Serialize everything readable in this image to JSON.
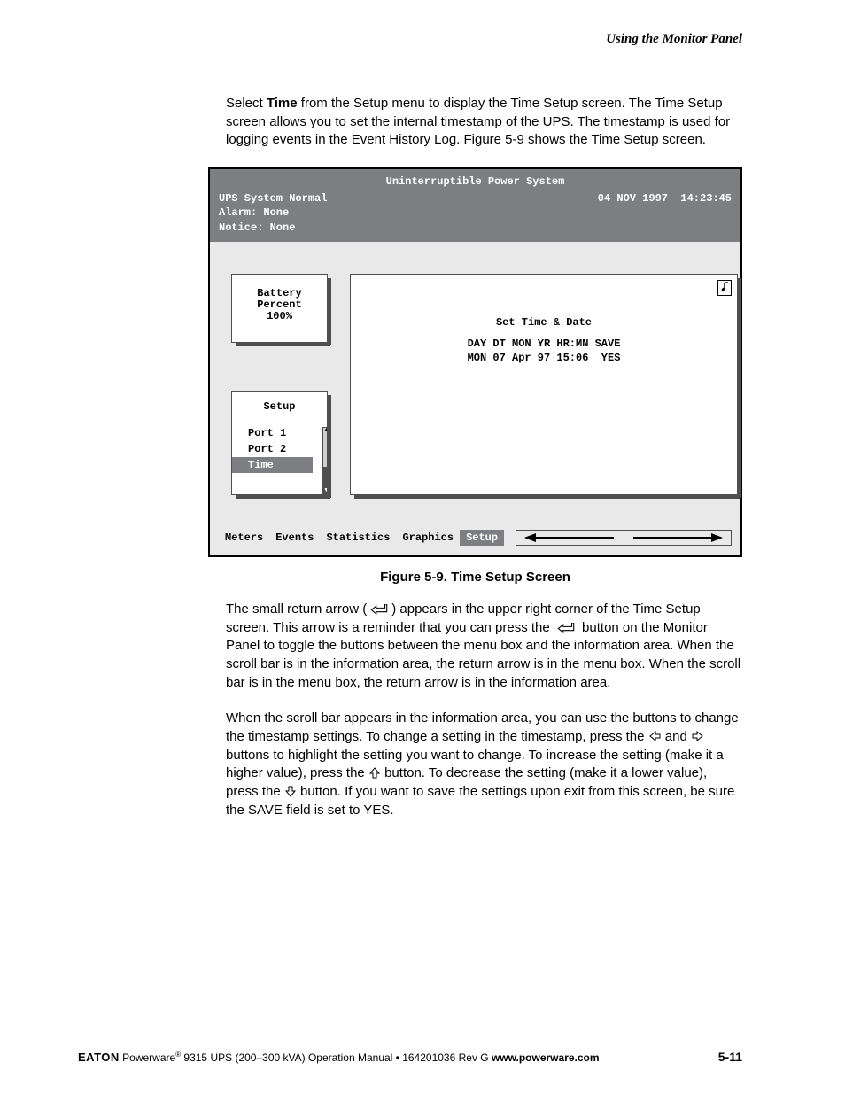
{
  "header": {
    "section_title": "Using the Monitor Panel"
  },
  "intro": {
    "p1_a": "Select ",
    "p1_bold": "Time",
    "p1_b": " from the Setup menu to display the Time Setup screen. The Time Setup screen allows you to set the internal timestamp of the UPS. The timestamp is used for logging events in the Event History Log. Figure 5-9 shows the Time Setup screen."
  },
  "lcd": {
    "title": "Uninterruptible Power System",
    "status_left_1": "UPS System Normal",
    "status_left_2": "Alarm:  None",
    "status_left_3": "Notice: None",
    "date": "04 NOV 1997",
    "time": "14:23:45",
    "battery": {
      "l1": "Battery",
      "l2": "Percent",
      "l3": "100%"
    },
    "setup": {
      "title": "Setup",
      "items": [
        "Port 1",
        "Port 2",
        "Time"
      ],
      "selected_index": 2
    },
    "info": {
      "title": "Set Time & Date",
      "header_row": "DAY DT MON YR HR:MN SAVE",
      "value_row": "MON 07 Apr 97 15:06  YES"
    },
    "footer_tabs": [
      "Meters",
      "Events",
      "Statistics",
      "Graphics",
      "Setup"
    ],
    "footer_selected_index": 4
  },
  "caption": "Figure 5-9. Time Setup Screen",
  "para2": {
    "a": "The small return arrow (",
    "b": ") appears in the upper right corner of the Time Setup screen. This arrow is a reminder that you can press the ",
    "c": " button on the Monitor Panel to toggle the buttons between the menu box and the information area. When the scroll bar is in the information area, the return arrow is in the menu box. When the scroll bar is in the menu box, the return arrow is in the information area."
  },
  "para3": {
    "a": "When the scroll bar appears in the information area, you can use the buttons to change the timestamp settings. To change a setting in the timestamp, press the ",
    "b": " and ",
    "c": " buttons to highlight the setting you want to change. To increase the setting (make it a higher value), press the ",
    "d": " button. To decrease the setting (make it a lower value), press the ",
    "e": " button. If you want to save the settings upon exit from this screen, be sure the SAVE field is set to YES."
  },
  "footer": {
    "brand": "EATON",
    "product_a": " Powerware",
    "reg": "®",
    "product_b": " 9315 UPS (200–300 kVA) Operation Manual  •  164201036 Rev G  ",
    "url": "www.powerware.com",
    "page": "5-11"
  }
}
